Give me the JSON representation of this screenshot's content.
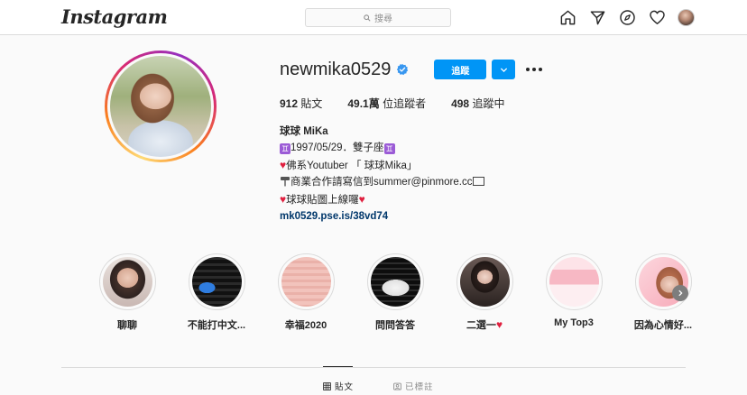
{
  "header": {
    "logo": "Instagram",
    "search_placeholder": "搜尋",
    "nav": [
      "home-icon",
      "direct-icon",
      "explore-icon",
      "activity-heart-icon",
      "profile-avatar"
    ]
  },
  "profile": {
    "username": "newmika0529",
    "verified": true,
    "follow_label": "追蹤",
    "stats": [
      {
        "value": "912",
        "label": " 貼文"
      },
      {
        "value": "49.1萬",
        "label": " 位追蹤者"
      },
      {
        "value": "498",
        "label": " 追蹤中"
      }
    ],
    "bio": {
      "name": "球球 MiKa",
      "line1_text": "1997/05/29．雙子座",
      "line2_text": "佛系Youtuber 「 球球Mika」",
      "line3_text": "商業合作請寫信到summer@pinmore.cc",
      "line4_text": "球球貼圖上線囉",
      "link": "mk0529.pse.is/38vd74"
    }
  },
  "highlights": [
    {
      "label": "聊聊"
    },
    {
      "label": "不能打中文..."
    },
    {
      "label": "幸福2020"
    },
    {
      "label": "問問答答"
    },
    {
      "label": "二選一"
    },
    {
      "label": "My Top3"
    },
    {
      "label": "因為心情好..."
    }
  ],
  "tabs": [
    {
      "label": "貼文",
      "icon": "grid-icon",
      "active": true
    },
    {
      "label": "已標註",
      "icon": "tagged-icon",
      "active": false
    }
  ],
  "colors": {
    "accent": "#0095f6",
    "link": "#00376b",
    "heart": "#e0203f"
  }
}
